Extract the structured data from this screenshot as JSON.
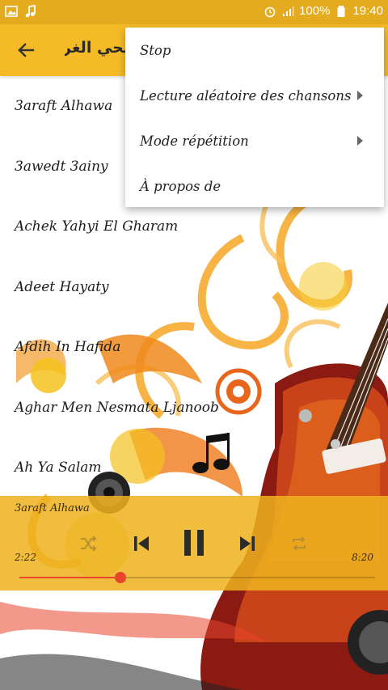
{
  "status_bar": {
    "battery": "100%",
    "time": "19:40"
  },
  "app_bar": {
    "title": "يحي الغرام"
  },
  "songs": [
    {
      "title": "3araft Alhawa"
    },
    {
      "title": "3awedt 3ainy"
    },
    {
      "title": "Achek Yahyi El Gharam"
    },
    {
      "title": "Adeet Hayaty"
    },
    {
      "title": "Afdih In Hafida"
    },
    {
      "title": "Aghar Men Nesmata Ljanoob"
    },
    {
      "title": "Ah Ya Salam"
    }
  ],
  "player": {
    "now_playing": "3araft Alhawa",
    "current_time": "2:22",
    "total_time": "8:20",
    "progress": 0.284
  },
  "menu": {
    "items": [
      {
        "label": "Stop",
        "has_submenu": false
      },
      {
        "label": "Lecture aléatoire des chansons",
        "has_submenu": true
      },
      {
        "label": "Mode répétition",
        "has_submenu": true
      },
      {
        "label": "À propos de",
        "has_submenu": false
      }
    ]
  },
  "colors": {
    "status_bar": "#e4ab1e",
    "app_bar": "#f4bb27",
    "player": "#eeb21e",
    "seek_accent": "#e8452c"
  }
}
